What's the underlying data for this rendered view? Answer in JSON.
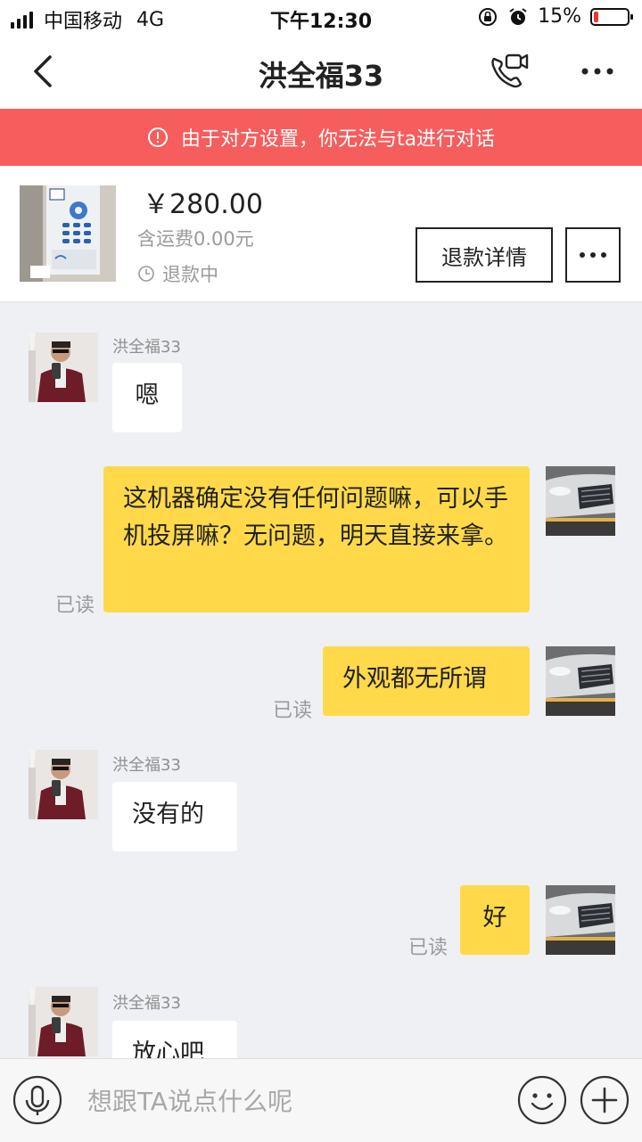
{
  "status_bar": {
    "carrier": "中国移动",
    "network": "4G",
    "time": "下午12:30",
    "battery_text": "15%",
    "battery_level": 0.15,
    "battery_color": "#e53935",
    "icons": [
      "signal-icon",
      "rotation-lock-icon",
      "alarm-icon",
      "battery-icon"
    ]
  },
  "nav": {
    "title": "洪全福33",
    "icons": [
      "back-icon",
      "video-call-icon",
      "more-icon"
    ]
  },
  "banner": {
    "text": "由于对方设置，你无法与ta进行对话",
    "color": "#f65d5d"
  },
  "product": {
    "price": "￥280.00",
    "shipping": "含运费0.00元",
    "status": "退款中",
    "refund_button": "退款详情"
  },
  "messages": [
    {
      "side": "left",
      "sender": "洪全福33",
      "text": "嗯"
    },
    {
      "side": "right",
      "text": "这机器确定没有任何问题嘛，可以手机投屏嘛？无问题，明天直接来拿。",
      "read": "已读"
    },
    {
      "side": "right",
      "text": "外观都无所谓",
      "read": "已读"
    },
    {
      "side": "left",
      "sender": "洪全福33",
      "text": "没有的"
    },
    {
      "side": "right",
      "text": "好",
      "read": "已读"
    },
    {
      "side": "left",
      "sender": "洪全福33",
      "text": "放心吧"
    }
  ],
  "input": {
    "placeholder": "想跟TA说点什么呢",
    "icons": [
      "microphone-icon",
      "emoji-icon",
      "plus-icon"
    ]
  },
  "colors": {
    "accent_yellow": "#ffd94a",
    "chat_background": "#eef0f4"
  }
}
